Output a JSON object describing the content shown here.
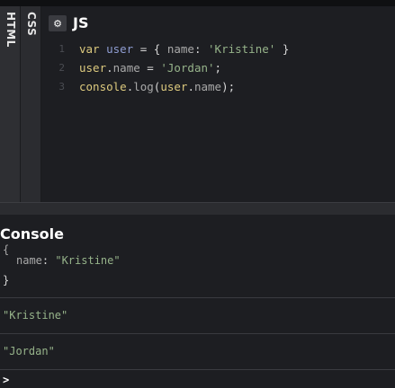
{
  "sidebar": {
    "tabs": [
      {
        "label": "HTML"
      },
      {
        "label": "CSS"
      }
    ]
  },
  "editor": {
    "title": "JS",
    "settings_icon": "gear-icon",
    "lines": [
      {
        "number": "1",
        "tokens": [
          {
            "t": "var",
            "c": "kw"
          },
          {
            "t": " ",
            "c": "pln"
          },
          {
            "t": "user",
            "c": "var"
          },
          {
            "t": " = { ",
            "c": "pln"
          },
          {
            "t": "name",
            "c": "prop"
          },
          {
            "t": ": ",
            "c": "pln"
          },
          {
            "t": "'Kristine'",
            "c": "str"
          },
          {
            "t": " }",
            "c": "pln"
          }
        ]
      },
      {
        "number": "2",
        "tokens": [
          {
            "t": "user",
            "c": "kw"
          },
          {
            "t": ".",
            "c": "pln"
          },
          {
            "t": "name",
            "c": "prop"
          },
          {
            "t": " = ",
            "c": "pln"
          },
          {
            "t": "'Jordan'",
            "c": "str"
          },
          {
            "t": ";",
            "c": "pln"
          }
        ]
      },
      {
        "number": "3",
        "tokens": [
          {
            "t": "console",
            "c": "kw"
          },
          {
            "t": ".",
            "c": "pln"
          },
          {
            "t": "log",
            "c": "prop"
          },
          {
            "t": "(",
            "c": "pln"
          },
          {
            "t": "user",
            "c": "kw"
          },
          {
            "t": ".",
            "c": "pln"
          },
          {
            "t": "name",
            "c": "prop"
          },
          {
            "t": ");",
            "c": "pln"
          }
        ]
      }
    ]
  },
  "console": {
    "title": "Console",
    "object": {
      "open": "{",
      "prop_name": "name",
      "prop_sep": ": ",
      "prop_value": "\"Kristine\"",
      "close": "}"
    },
    "logs": [
      "\"Kristine\"",
      "\"Jordan\""
    ],
    "prompt": ">"
  },
  "colors": {
    "background": "#1d1e22",
    "panel": "#2b2c30",
    "keyword": "#ddca7e",
    "variable": "#8f9dd2",
    "string": "#96b38a",
    "property": "#a9a9a9"
  }
}
